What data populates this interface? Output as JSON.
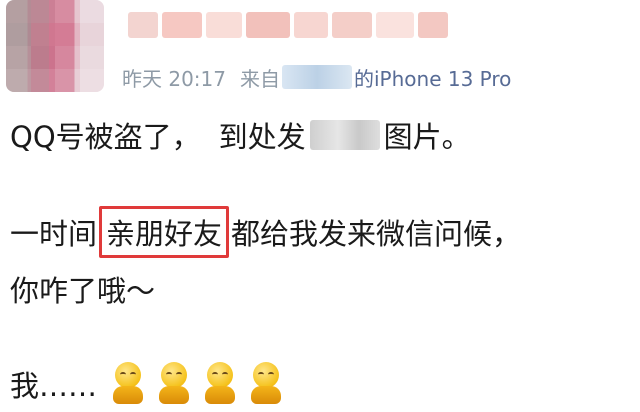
{
  "post": {
    "meta": {
      "date": "昨天 20:17",
      "source_prefix": "来自",
      "source_suffix": "的iPhone 13 Pro"
    },
    "line1_prefix": "QQ号被盗了，",
    "line1_mid": "到处发",
    "line1_suffix": "图片。",
    "line2_prefix": "一时间",
    "line2_highlight": "亲朋好友",
    "line2_suffix": "都给我发来微信问候，",
    "line3": "你咋了哦～",
    "line4": "我……"
  },
  "emoji": [
    "kneeling-smile-emoji",
    "kneeling-smile-emoji",
    "kneeling-smile-emoji",
    "kneeling-smile-emoji"
  ],
  "colors": {
    "meta_text": "#8e9aa6",
    "device_link": "#576b95",
    "highlight_border": "#e03a3a"
  }
}
